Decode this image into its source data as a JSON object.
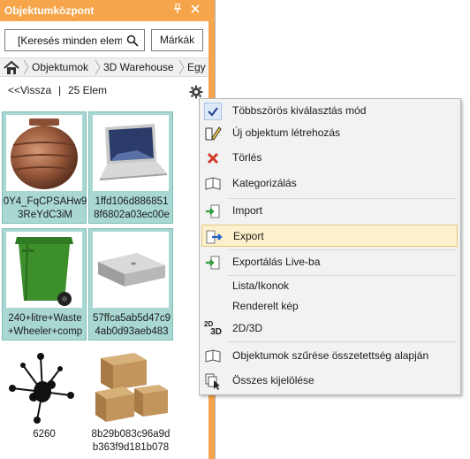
{
  "panel": {
    "title": "Objektumközpont",
    "pin_icon": "pin-icon",
    "close_icon": "close-icon",
    "search_placeholder": "[Keresés minden elem",
    "brands_button": "Márkák",
    "breadcrumbs": [
      "Objektumok",
      "3D Warehouse",
      "Egy"
    ],
    "back_label": "<<Vissza",
    "separator": "|",
    "count_label": "25 Elem"
  },
  "items": [
    {
      "line1": "0Y4_FqCPSAHw9",
      "line2": "3ReYdC3iM",
      "thumb": "copper-pot",
      "selected": true
    },
    {
      "line1": "1ffd106d886851",
      "line2": "8f6802a03ec00e",
      "thumb": "laptop",
      "selected": true
    },
    {
      "line1": "240+litre+Waste",
      "line2": "+Wheeler+comp",
      "thumb": "green-wheelie-bin",
      "selected": true
    },
    {
      "line1": "57ffca5ab5d47c9",
      "line2": "4ab0d93aeb483",
      "thumb": "mac-mini",
      "selected": true
    },
    {
      "line1": "6260",
      "line2": "",
      "thumb": "molecule-model",
      "selected": false
    },
    {
      "line1": "8b29b083c96a9d",
      "line2": "b363f9d181b078",
      "thumb": "cardboard-boxes",
      "selected": false
    }
  ],
  "menu": {
    "items": [
      {
        "label": "Többszörös kiválasztás mód",
        "icon": "checkmark-icon",
        "checked": true
      },
      {
        "label": "Új objektum létrehozás",
        "icon": "new-object-pencil-icon"
      },
      {
        "label": "Törlés",
        "icon": "delete-x-icon"
      },
      {
        "label": "Kategorizálás",
        "icon": "categorize-book-icon"
      },
      {
        "label": "Import",
        "icon": "import-icon"
      },
      {
        "label": "Export",
        "icon": "export-icon",
        "highlighted": true
      },
      {
        "label": "Exportálás Live-ba",
        "icon": "export-live-icon"
      },
      {
        "label": "Lista/Ikonok",
        "icon": ""
      },
      {
        "label": "Renderelt kép",
        "icon": ""
      },
      {
        "label": "2D/3D",
        "icon": "2d-3d-icon"
      },
      {
        "label": "Objektumok szűrése összetettség alapján",
        "icon": "filter-complexity-icon"
      },
      {
        "label": "Összes kijelölése",
        "icon": "select-all-icon"
      }
    ],
    "icon_2d": "2D",
    "icon_3d": "3D"
  },
  "colors": {
    "title_bar": "#f6a54a",
    "selected_tile": "#a9d8d2",
    "menu_highlight": "#fdf0cc"
  }
}
